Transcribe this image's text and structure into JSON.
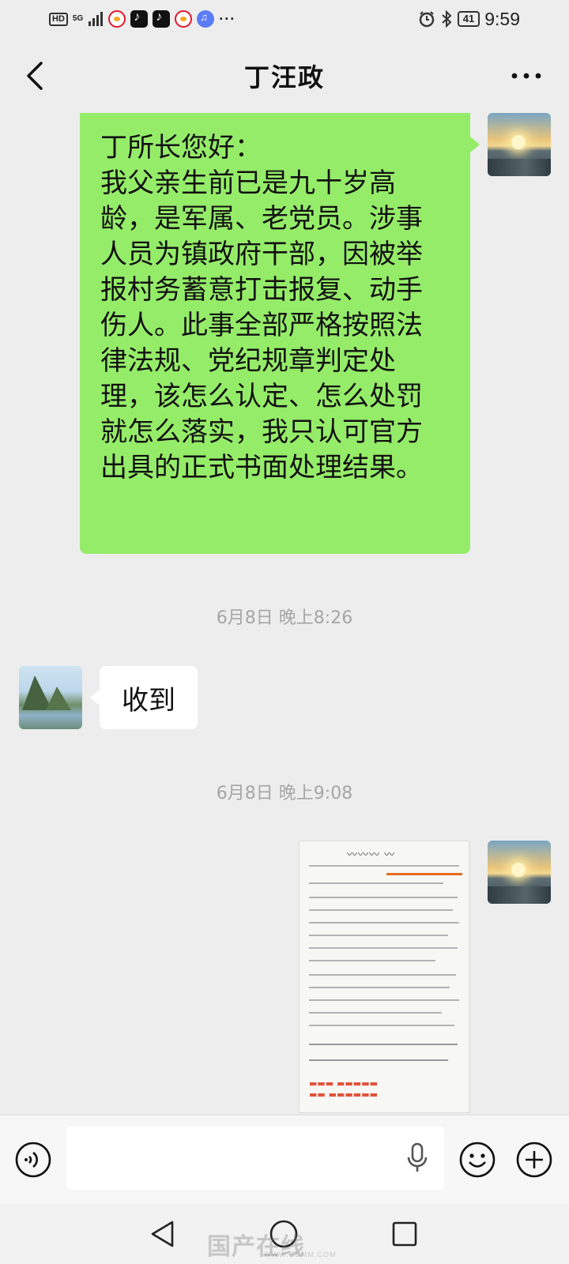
{
  "status_bar": {
    "hd_badge": "HD",
    "network": "5G",
    "battery": "41",
    "time": "9:59",
    "icons": [
      "weibo-icon",
      "tiktok-icon",
      "tiktok-icon",
      "weibo-icon",
      "music-icon",
      "alarm-icon",
      "bluetooth-icon"
    ]
  },
  "header": {
    "title": "丁汪政",
    "back_icon": "chevron-left-icon",
    "more_icon": "more-dots-icon"
  },
  "messages": {
    "outgoing_text": {
      "lines": [
        "丁所长您好：",
        "我父亲生前已是九十岁高",
        "龄，是军属、老党员。涉事",
        "人员为镇政府干部，因被举",
        "报村务蓄意打击报复、动手",
        "伤人。此事全部严格按照法",
        "律法规、党纪规章判定处",
        "理，该怎么认定、怎么处罚",
        "就怎么落实，我只认可官方",
        "出具的正式书面处理结果。"
      ],
      "bubble_color": "#95ec69"
    },
    "timestamp_1": "6月8日 晚上8:26",
    "incoming_text": "收到",
    "timestamp_2": "6月8日 晚上9:08",
    "outgoing_image": {
      "description_visible": "handwritten-document-photo"
    }
  },
  "input_bar": {
    "voice_icon": "voice-toggle-icon",
    "input_placeholder": "",
    "mic_icon": "microphone-icon",
    "emoji_icon": "emoji-icon",
    "plus_icon": "plus-circle-icon"
  },
  "nav_bar": {
    "back": "nav-back-icon",
    "home": "nav-home-icon",
    "recent": "nav-recent-icon",
    "watermark_main": "国产在线",
    "watermark_sub": "WWW.GDMM.COM"
  },
  "colors": {
    "chat_background": "#ededed",
    "outgoing_bubble": "#95ec69",
    "incoming_bubble": "#ffffff",
    "timestamp_text": "#a6a6a6"
  }
}
